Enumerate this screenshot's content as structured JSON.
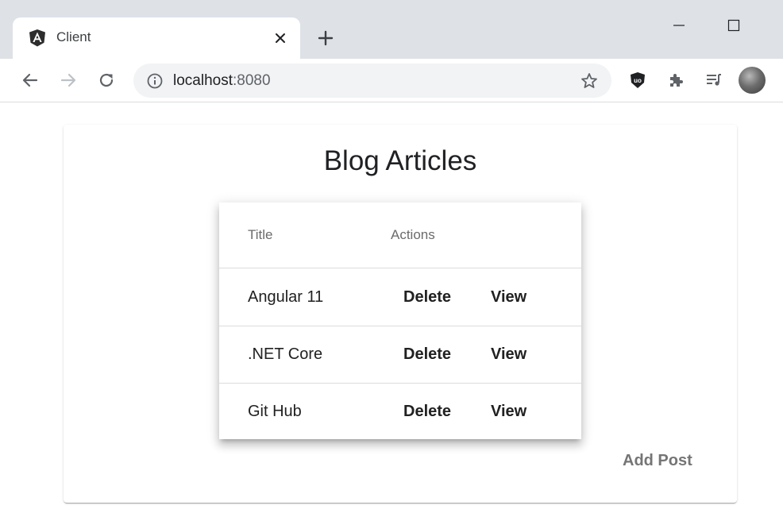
{
  "browser": {
    "tab": {
      "title": "Client",
      "favicon": "angular-icon"
    },
    "url": {
      "host": "localhost",
      "port": ":8080"
    },
    "icons": {
      "back": "arrow-left-icon",
      "forward": "arrow-right-icon",
      "reload": "reload-icon",
      "info": "info-icon",
      "star": "star-icon",
      "ublock": "ublock-icon",
      "extensions": "puzzle-icon",
      "media": "queue-music-icon"
    }
  },
  "page": {
    "title": "Blog Articles",
    "table": {
      "headers": [
        "Title",
        "Actions"
      ],
      "rows": [
        {
          "title": "Angular 11",
          "delete": "Delete",
          "view": "View"
        },
        {
          "title": ".NET Core",
          "delete": "Delete",
          "view": "View"
        },
        {
          "title": "Git Hub",
          "delete": "Delete",
          "view": "View"
        }
      ]
    },
    "add_post_label": "Add Post"
  },
  "colors": {
    "tabstrip": "#dee1e6",
    "omnibox": "#f1f3f4",
    "text": "#202124",
    "muted": "#757575"
  }
}
